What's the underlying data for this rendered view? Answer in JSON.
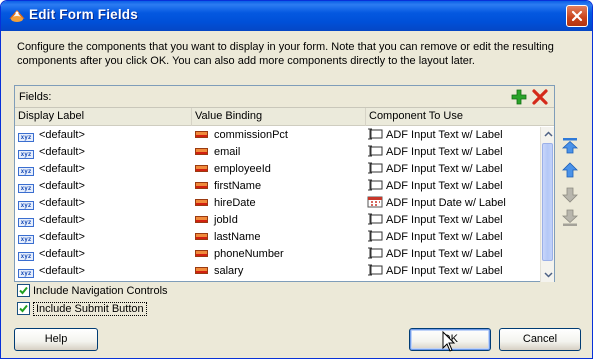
{
  "window": {
    "title": "Edit Form Fields"
  },
  "instructions": "Configure the components that you want to display in your form.  Note that you can remove or edit the resulting components after you click OK.  You can also add more components directly to the layout later.",
  "fields": {
    "label": "Fields:",
    "columns": [
      "Display Label",
      "Value Binding",
      "Component To Use"
    ],
    "rows": [
      {
        "label": "<default>",
        "binding": "commissionPct",
        "component": "ADF Input Text w/ Label",
        "component_icon": "input-text-icon"
      },
      {
        "label": "<default>",
        "binding": "email",
        "component": "ADF Input Text w/ Label",
        "component_icon": "input-text-icon"
      },
      {
        "label": "<default>",
        "binding": "employeeId",
        "component": "ADF Input Text w/ Label",
        "component_icon": "input-text-icon"
      },
      {
        "label": "<default>",
        "binding": "firstName",
        "component": "ADF Input Text w/ Label",
        "component_icon": "input-text-icon"
      },
      {
        "label": "<default>",
        "binding": "hireDate",
        "component": "ADF Input Date w/ Label",
        "component_icon": "input-date-icon"
      },
      {
        "label": "<default>",
        "binding": "jobId",
        "component": "ADF Input Text w/ Label",
        "component_icon": "input-text-icon"
      },
      {
        "label": "<default>",
        "binding": "lastName",
        "component": "ADF Input Text w/ Label",
        "component_icon": "input-text-icon"
      },
      {
        "label": "<default>",
        "binding": "phoneNumber",
        "component": "ADF Input Text w/ Label",
        "component_icon": "input-text-icon"
      },
      {
        "label": "<default>",
        "binding": "salary",
        "component": "ADF Input Text w/ Label",
        "component_icon": "input-text-icon"
      }
    ]
  },
  "options": {
    "navigation": {
      "label": "Include Navigation Controls",
      "checked": true
    },
    "submit": {
      "label": "Include Submit Button",
      "checked": true
    }
  },
  "buttons": {
    "help": "Help",
    "ok": "OK",
    "cancel": "Cancel"
  },
  "colors": {
    "title_bar": "#0458e0",
    "dialog_bg": "#ece9d8",
    "add": "#2aa32a",
    "delete": "#d42a1a",
    "move_arrow": "#2f7ad8"
  }
}
